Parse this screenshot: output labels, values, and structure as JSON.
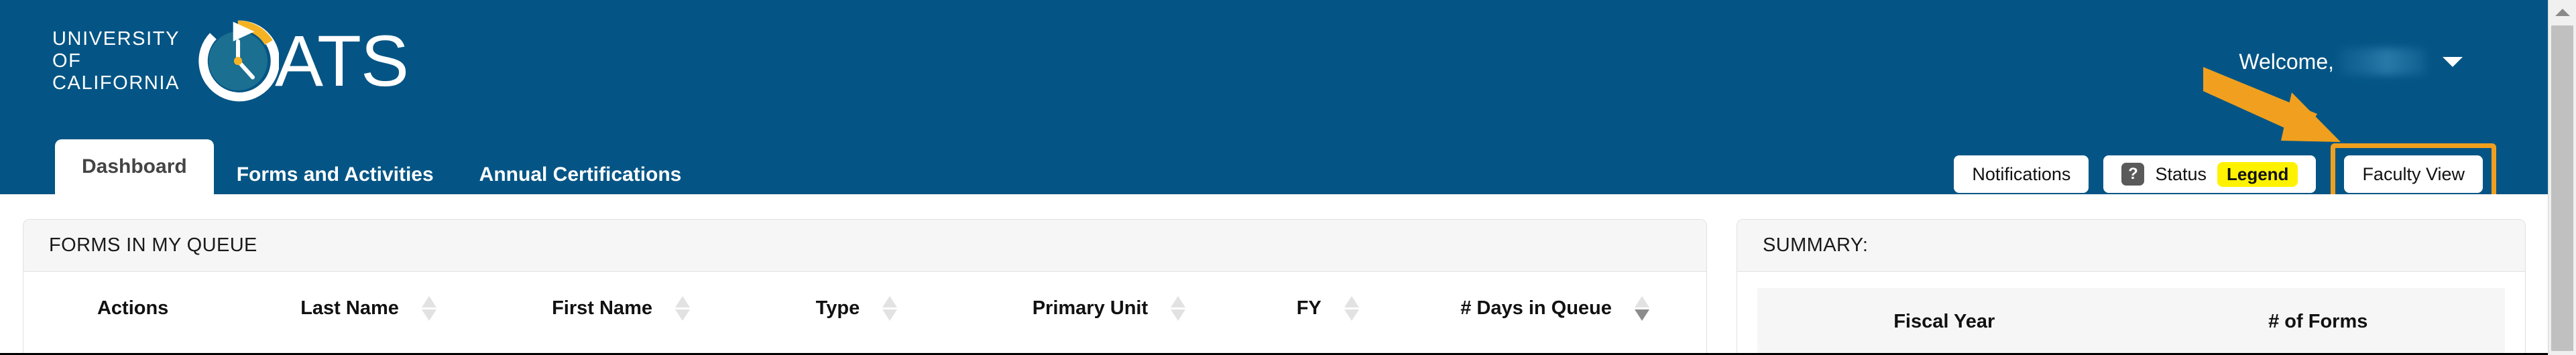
{
  "brand": {
    "university_line1": "UNIVERSITY",
    "university_line2": "OF",
    "university_line3": "CALIFORNIA",
    "app_name": "ATS",
    "logo_mark": "oats-clock-icon",
    "header_color": "#045585",
    "accent_color": "#f0a01e",
    "highlight_color": "#fff200"
  },
  "account": {
    "welcome_label": "Welcome,",
    "username": "",
    "caret": "chevron-down-icon"
  },
  "tabs": [
    {
      "label": "Dashboard",
      "active": true
    },
    {
      "label": "Forms and Activities",
      "active": false
    },
    {
      "label": "Annual Certifications",
      "active": false
    }
  ],
  "header_actions": {
    "notifications_label": "Notifications",
    "status_label": "Status",
    "status_icon": "question-mark-icon",
    "legend_badge": "Legend",
    "faculty_view_label": "Faculty View",
    "faculty_view_highlighted": true
  },
  "annotation": {
    "arrow": "orange-arrow-pointing-to-faculty-view"
  },
  "queue_panel": {
    "title": "FORMS IN MY QUEUE",
    "columns": [
      {
        "label": "Actions",
        "sortable": false,
        "sort": "none"
      },
      {
        "label": "Last Name",
        "sortable": true,
        "sort": "none"
      },
      {
        "label": "First Name",
        "sortable": true,
        "sort": "none"
      },
      {
        "label": "Type",
        "sortable": true,
        "sort": "none"
      },
      {
        "label": "Primary Unit",
        "sortable": true,
        "sort": "none"
      },
      {
        "label": "FY",
        "sortable": true,
        "sort": "none"
      },
      {
        "label": "# Days in Queue",
        "sortable": true,
        "sort": "desc"
      }
    ],
    "rows": []
  },
  "summary_panel": {
    "title": "SUMMARY:",
    "columns": [
      "Fiscal Year",
      "# of Forms"
    ],
    "rows": []
  },
  "scrollbar": {
    "up_arrow": "scroll-up-arrow-icon"
  }
}
